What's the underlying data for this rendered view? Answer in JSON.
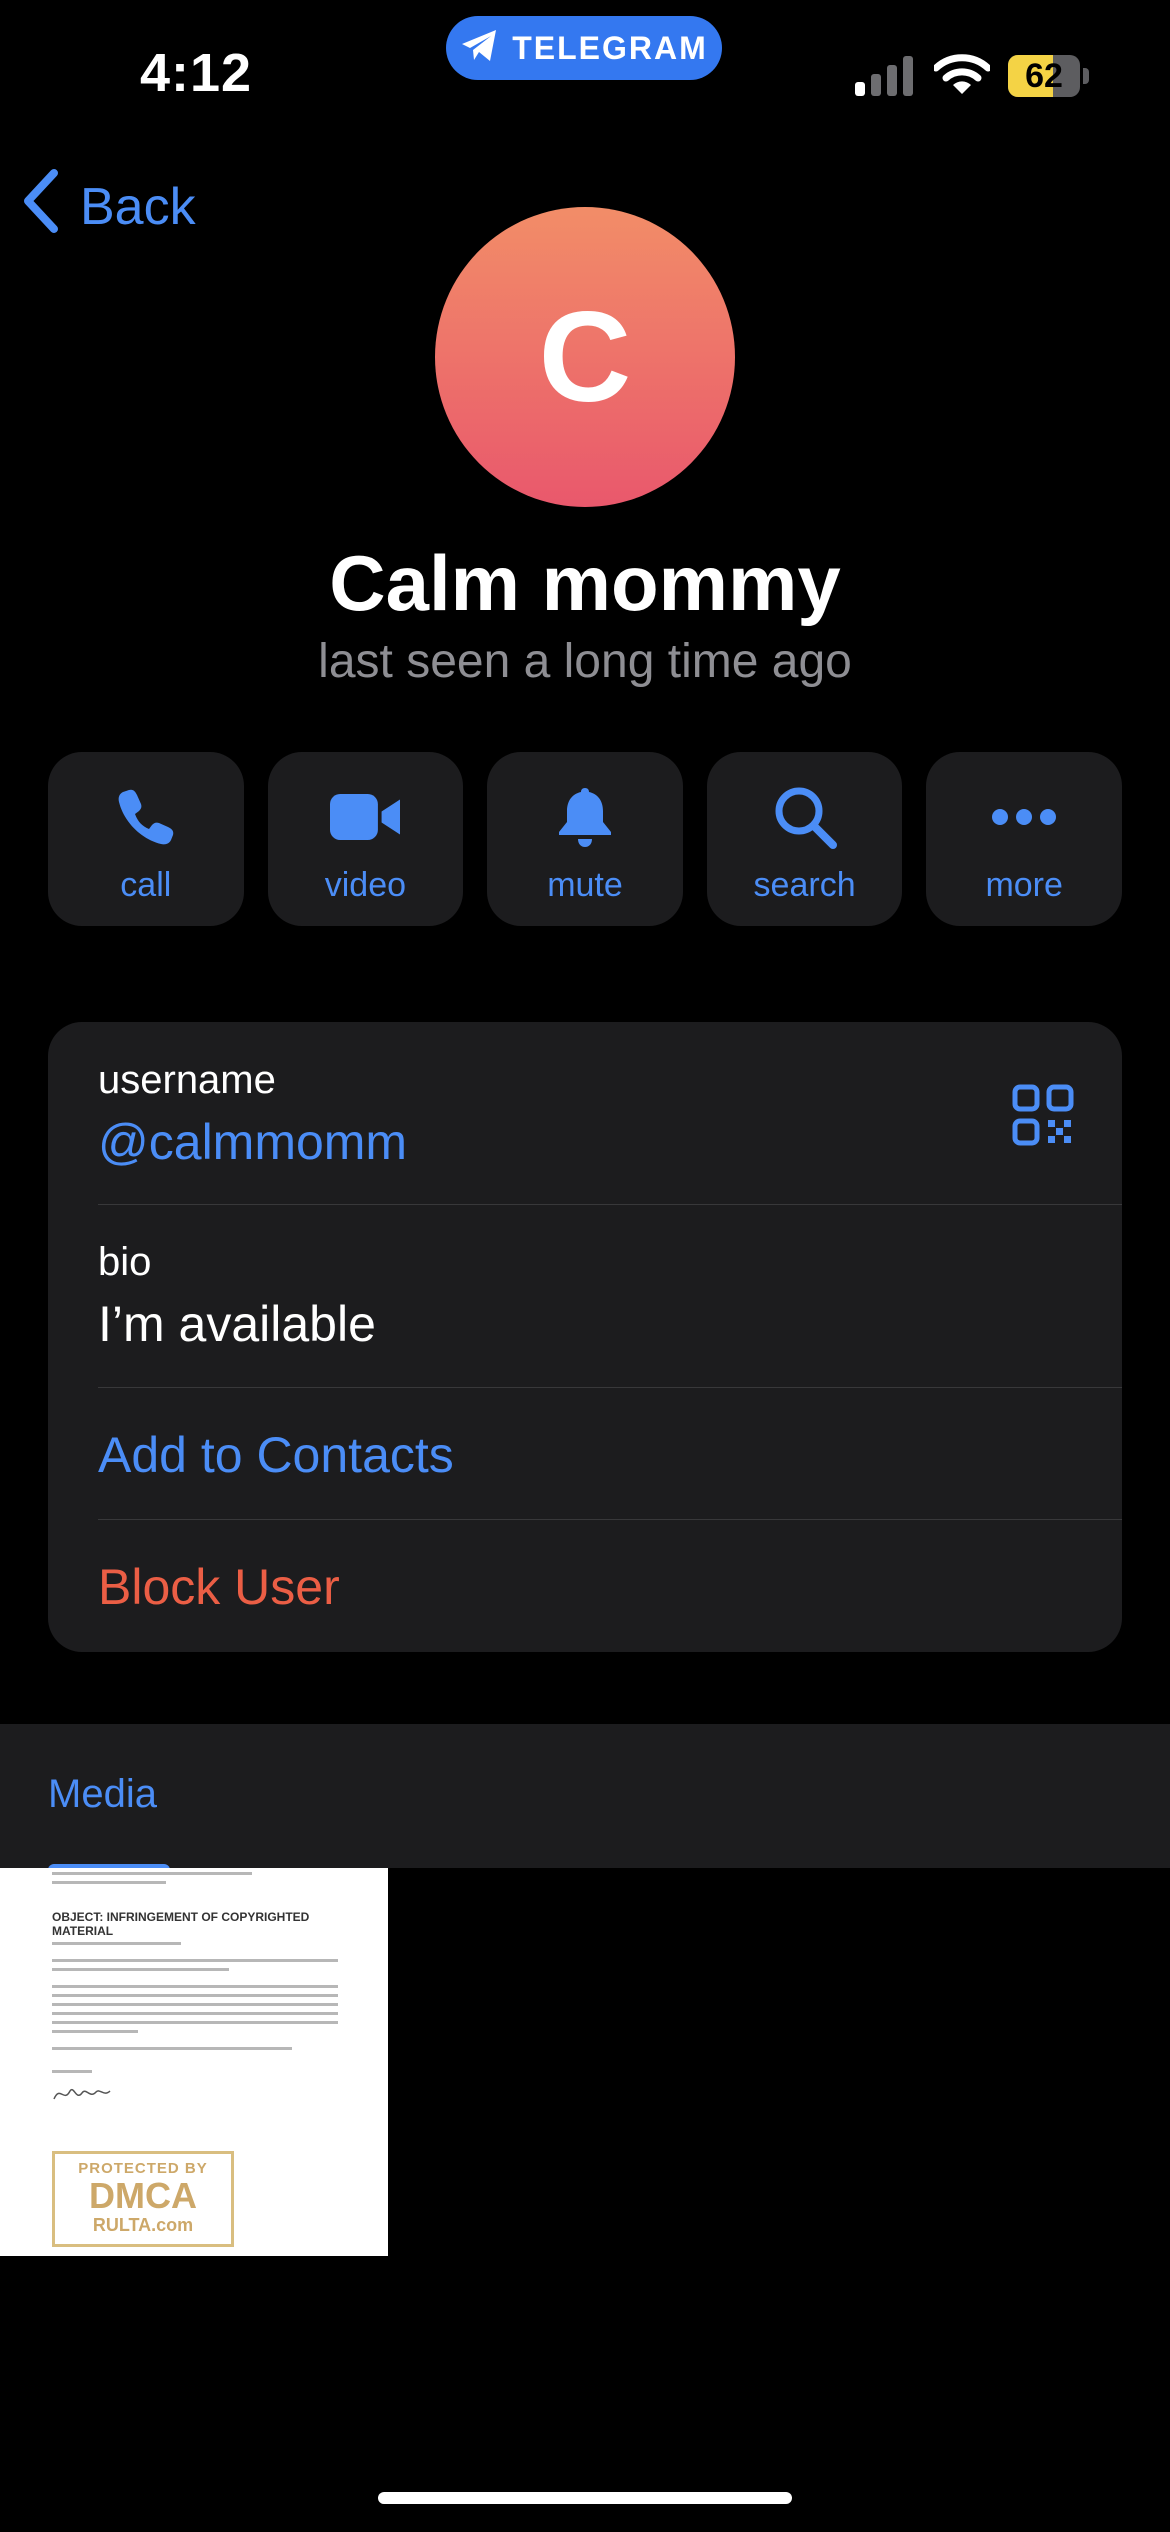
{
  "status_bar": {
    "time": "4:12",
    "app_pill": "TELEGRAM",
    "battery": "62",
    "battery_level": 0.62
  },
  "nav": {
    "back_label": "Back"
  },
  "profile": {
    "avatar_letter": "C",
    "name": "Calm mommy",
    "status": "last seen a long time ago"
  },
  "actions": [
    {
      "label": "call",
      "icon": "phone-icon"
    },
    {
      "label": "video",
      "icon": "video-camera-icon"
    },
    {
      "label": "mute",
      "icon": "bell-icon"
    },
    {
      "label": "search",
      "icon": "search-icon"
    },
    {
      "label": "more",
      "icon": "more-dots-icon"
    }
  ],
  "info": {
    "username_label": "username",
    "username_value": "@calmmomm",
    "bio_label": "bio",
    "bio_value": "I’m available",
    "add_contact": "Add to Contacts",
    "block_user": "Block User"
  },
  "media": {
    "tab_label": "Media",
    "document": {
      "heading": "OBJECT: INFRINGEMENT OF COPYRIGHTED MATERIAL",
      "stamp_top": "PROTECTED BY",
      "stamp_main": "DMCA",
      "stamp_bottom": "RULTA.com"
    }
  },
  "colors": {
    "accent": "#4b8df6",
    "destructive": "#eb5e45",
    "card": "#1c1c1e",
    "background": "#000000"
  }
}
